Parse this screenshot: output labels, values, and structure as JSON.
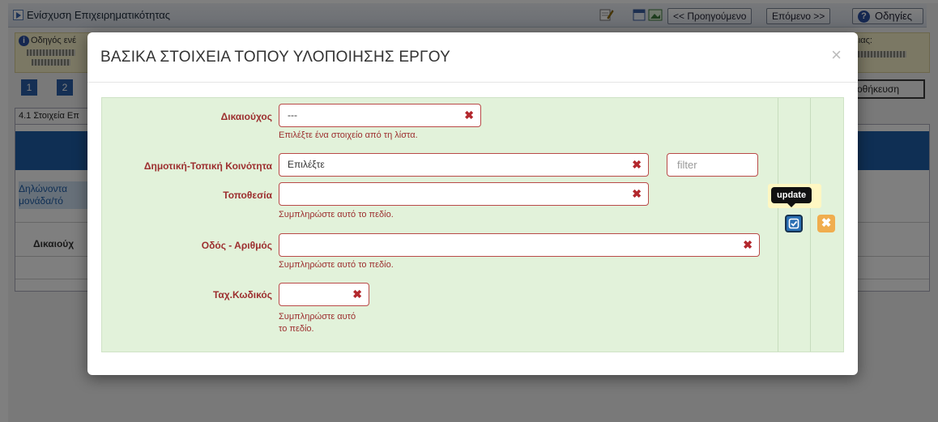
{
  "app": {
    "title": "Ενίσχυση Επιχειρηματικότητας",
    "nav": {
      "prev_label": "<< Προηγούμενο",
      "next_label": "Επόμενο >>",
      "help_label": "Οδηγίες"
    },
    "info_prefix": "Οδηγός ενέ",
    "info_right_label": "ειας:",
    "steps": [
      "1",
      "2"
    ],
    "save_label": "οθήκευση",
    "section_tab": "4.1 Στοιχεία Επ",
    "blue_text_line1": "Δηλώνοντα",
    "blue_text_line2": "μονάδα/τό",
    "col_header": "Δικαιούχ"
  },
  "modal": {
    "title": "ΒΑΣΙΚΑ ΣΤΟΙΧΕΙΑ ΤΟΠΟΥ ΥΛΟΠΟΙΗΣΗΣ ΕΡΓΟΥ",
    "close_glyph": "×",
    "fields": {
      "beneficiary": {
        "label": "Δικαιούχος",
        "value": "---",
        "help": "Επιλέξτε ένα στοιχείο από τη λίστα."
      },
      "community": {
        "label": "Δημοτική-Τοπική Κοινότητα",
        "value": "Επιλέξτε",
        "filter_placeholder": "filter"
      },
      "location": {
        "label": "Τοποθεσία",
        "value": "",
        "help": "Συμπληρώστε αυτό το πεδίο."
      },
      "street": {
        "label": "Οδός - Αριθμός",
        "value": "",
        "help": "Συμπληρώστε αυτό το πεδίο."
      },
      "postal": {
        "label": "Ταχ.Κωδικός",
        "value": "",
        "help_line1": "Συμπληρώστε αυτό",
        "help_line2": "το πεδίο."
      }
    },
    "clear_glyph": "✖",
    "actions": {
      "update_tooltip": "update",
      "cancel_glyph": "✖"
    }
  },
  "colors": {
    "error_red": "#b94a48",
    "form_green": "#e2f2da",
    "update_blue": "#2a6fb3",
    "cancel_orange": "#f0ad4e"
  }
}
